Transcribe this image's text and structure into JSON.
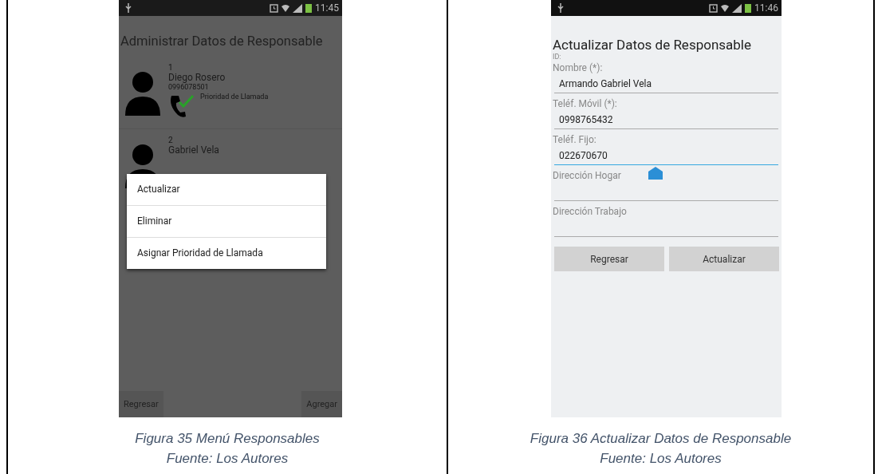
{
  "figures": [
    {
      "kind": "menu_screen",
      "status_time": "11:45",
      "title": "Administrar Datos de Responsable",
      "contacts": [
        {
          "number": "1",
          "name": "Diego Rosero",
          "phone": "0996078501",
          "priority": true,
          "priority_label": "Prioridad de Llamada"
        },
        {
          "number": "2",
          "name": "Gabriel Vela",
          "priority": false
        }
      ],
      "menu": [
        "Actualizar",
        "Eliminar",
        "Asignar Prioridad de Llamada"
      ],
      "buttons": [
        "Regresar",
        "Agregar"
      ],
      "caption": "Figura 35 Menú Responsables",
      "source": "Fuente: Los Autores"
    },
    {
      "kind": "form_screen",
      "status_time": "11:46",
      "title": "Actualizar Datos de Responsable",
      "id_label": "ID:",
      "fields": [
        {
          "label": "Nombre (*):",
          "value": "Armando Gabriel Vela",
          "focused": false
        },
        {
          "label": "Teléf. Móvil (*):",
          "value": "0998765432",
          "focused": false
        },
        {
          "label": "Teléf. Fijo:",
          "value": "022670670",
          "focused": true
        },
        {
          "label": "Dirección Hogar",
          "focused": false
        },
        {
          "label": "Dirección Trabajo",
          "focused": false
        }
      ],
      "buttons": [
        "Regresar",
        "Actualizar"
      ],
      "caption": "Figura 36 Actualizar Datos de Responsable",
      "source": "Fuente: Los Autores"
    }
  ]
}
